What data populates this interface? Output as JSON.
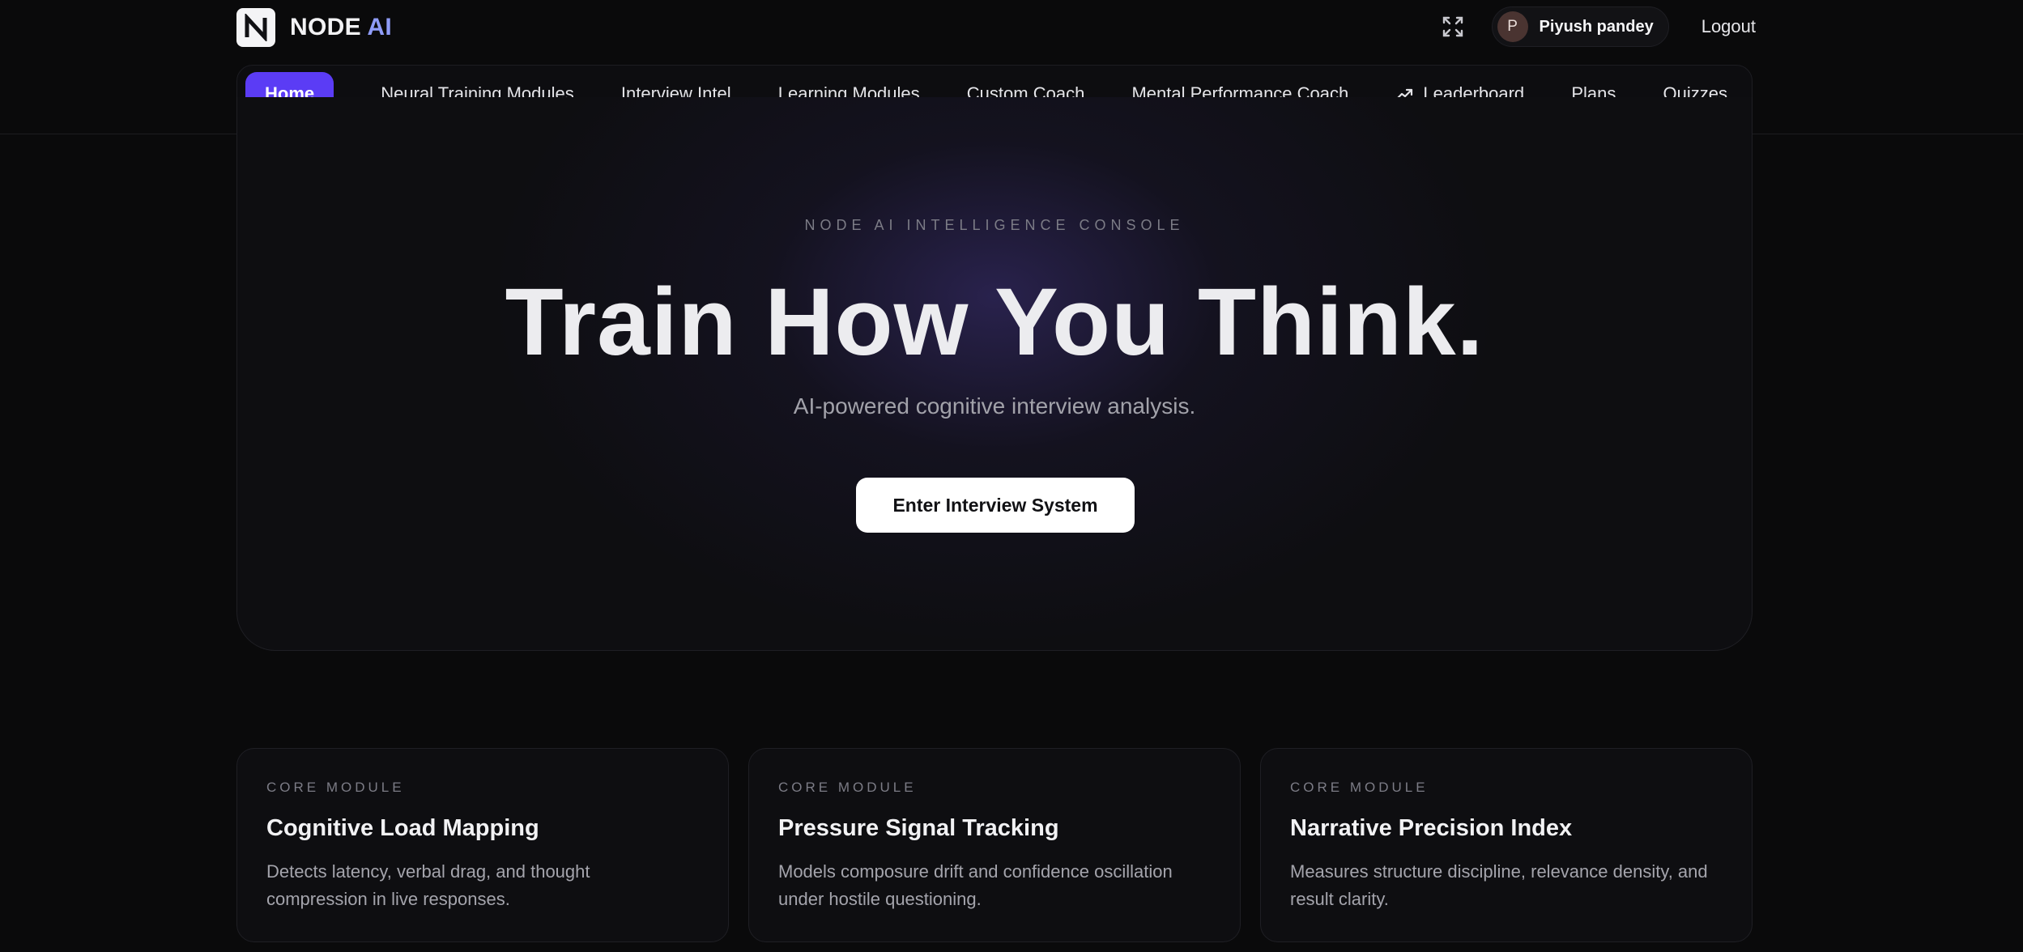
{
  "brand": {
    "name_main": "NODE",
    "name_accent": "AI",
    "accent_color": "#8f9cf7"
  },
  "header": {
    "fullscreen_icon": "expand-icon",
    "user": {
      "avatar_letter": "P",
      "name": "Piyush pandey"
    },
    "logout_label": "Logout"
  },
  "nav": {
    "active_color": "#5b3cf5",
    "items": [
      {
        "label": "Home",
        "active": true
      },
      {
        "label": "Neural Training Modules"
      },
      {
        "label": "Interview Intel"
      },
      {
        "label": "Learning Modules"
      },
      {
        "label": "Custom Coach"
      },
      {
        "label": "Mental Performance Coach"
      },
      {
        "label": "Leaderboard",
        "icon": "trending-up-icon"
      },
      {
        "label": "Plans"
      },
      {
        "label": "Quizzes"
      }
    ]
  },
  "hero": {
    "eyebrow": "NODE AI INTELLIGENCE CONSOLE",
    "headline": "Train How You Think.",
    "subline": "AI-powered cognitive interview analysis.",
    "cta_label": "Enter Interview System"
  },
  "modules": [
    {
      "eyebrow": "CORE MODULE",
      "title": "Cognitive Load Mapping",
      "description_line1": "Detects latency, verbal drag, and thought",
      "description_line2": "compression in live responses."
    },
    {
      "eyebrow": "CORE MODULE",
      "title": "Pressure Signal Tracking",
      "description_line1": "Models composure drift and confidence oscillation",
      "description_line2": "under hostile questioning."
    },
    {
      "eyebrow": "CORE MODULE",
      "title": "Narrative Precision Index",
      "description_line1": "Measures structure discipline, relevance density, and",
      "description_line2": "result clarity."
    }
  ]
}
